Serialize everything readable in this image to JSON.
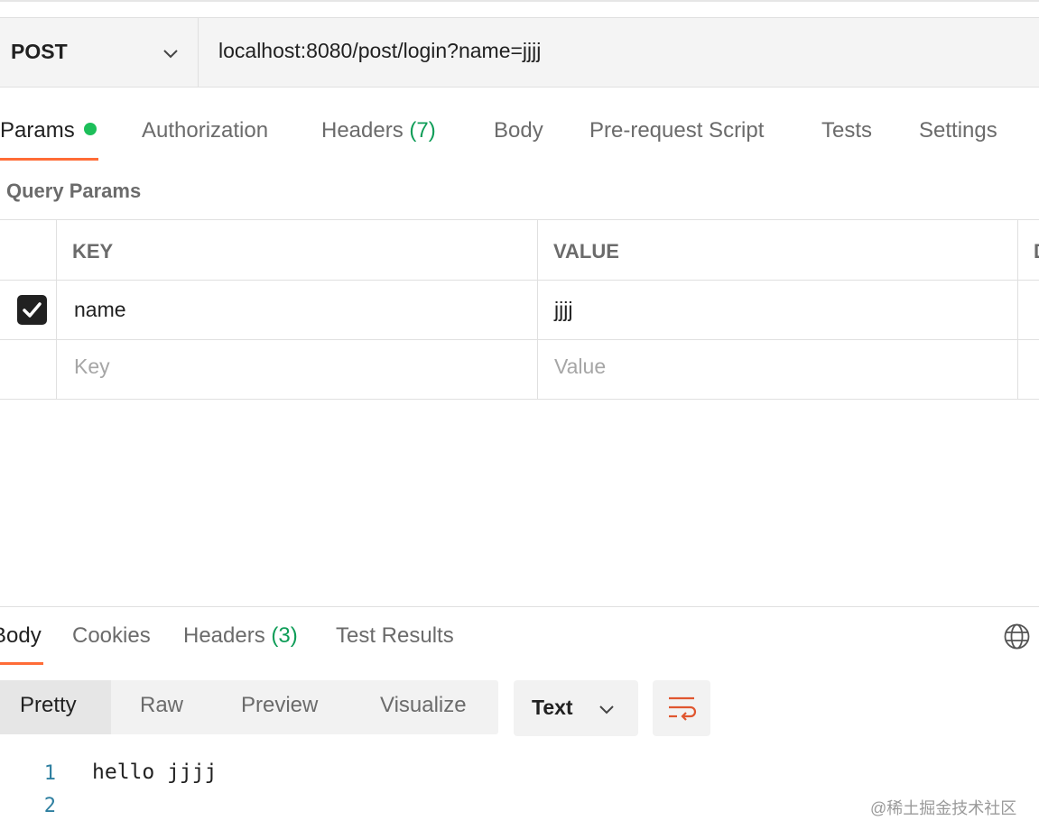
{
  "request": {
    "method": "POST",
    "url": "localhost:8080/post/login?name=jjjj"
  },
  "request_tabs": {
    "params": "Params",
    "authorization": "Authorization",
    "headers": "Headers",
    "headers_count": "(7)",
    "body": "Body",
    "pre_request": "Pre-request Script",
    "tests": "Tests",
    "settings": "Settings"
  },
  "query_params": {
    "title": "Query Params",
    "columns": {
      "key": "KEY",
      "value": "VALUE",
      "third_partial": "D"
    },
    "rows": [
      {
        "checked": true,
        "key": "name",
        "value": "jjjj"
      }
    ],
    "placeholder": {
      "key": "Key",
      "value": "Value"
    }
  },
  "response": {
    "tabs": {
      "body": "Body",
      "cookies": "Cookies",
      "headers": "Headers",
      "headers_count": "(3)",
      "test_results": "Test Results"
    },
    "views": {
      "pretty": "Pretty",
      "raw": "Raw",
      "preview": "Preview",
      "visualize": "Visualize"
    },
    "format": "Text",
    "lines": [
      {
        "number": "1",
        "text": "hello jjjj"
      },
      {
        "number": "2",
        "text": ""
      }
    ]
  },
  "watermark": "@稀土掘金技术社区",
  "colors": {
    "accent": "#ff6c37",
    "green": "#1dbf5a",
    "line_numbers": "#2e7fa0"
  }
}
